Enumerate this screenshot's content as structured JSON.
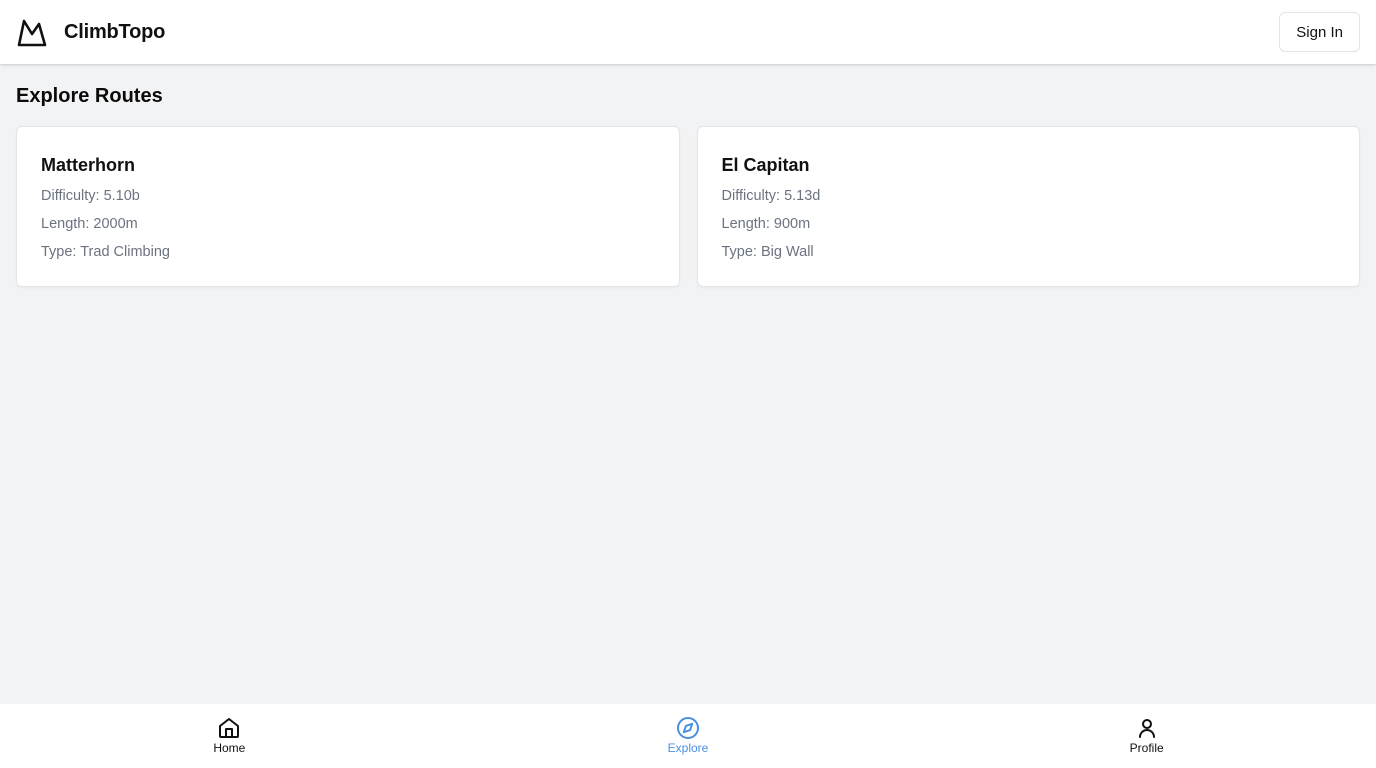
{
  "header": {
    "brand_name": "ClimbTopo",
    "sign_in_label": "Sign In"
  },
  "main": {
    "title": "Explore Routes",
    "routes": [
      {
        "name": "Matterhorn",
        "difficulty": "Difficulty: 5.10b",
        "length": "Length: 2000m",
        "type": "Type: Trad Climbing"
      },
      {
        "name": "El Capitan",
        "difficulty": "Difficulty: 5.13d",
        "length": "Length: 900m",
        "type": "Type: Big Wall"
      }
    ]
  },
  "bottom_nav": {
    "items": [
      {
        "label": "Home",
        "icon": "home-icon"
      },
      {
        "label": "Explore",
        "icon": "compass-icon",
        "active": true
      },
      {
        "label": "Profile",
        "icon": "user-icon"
      }
    ]
  },
  "colors": {
    "accent": "#4a90e2",
    "background": "#f2f3f5",
    "muted_text": "#6b7280"
  }
}
